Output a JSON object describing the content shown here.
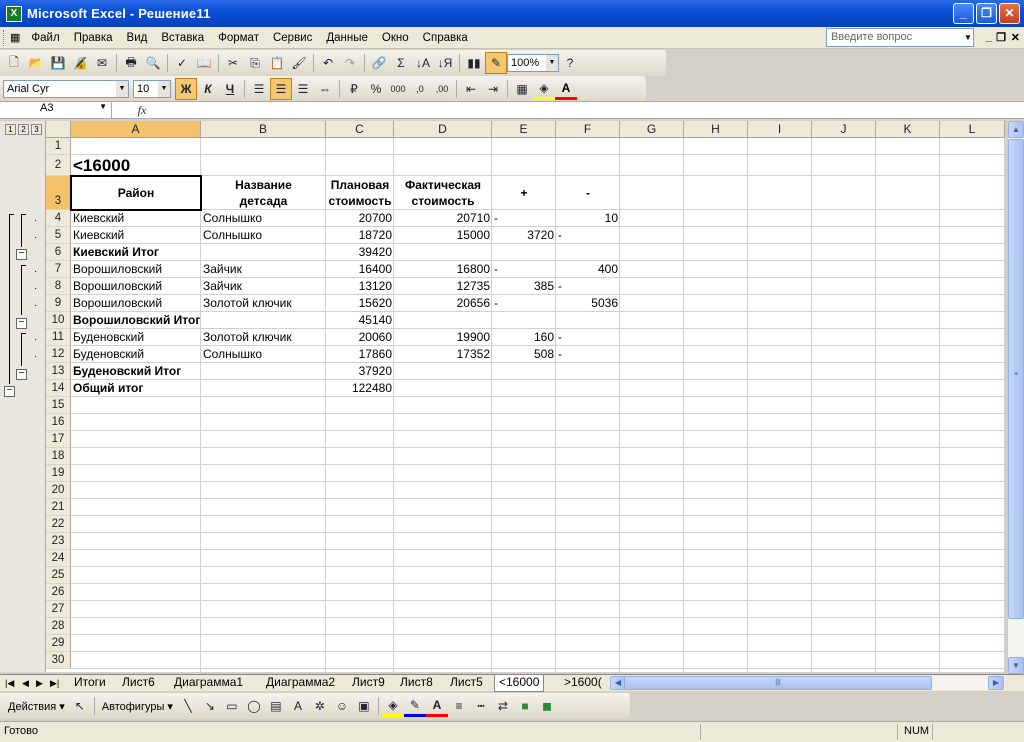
{
  "window": {
    "title": "Microsoft Excel - Решение11",
    "icon": "excel-icon"
  },
  "menu": [
    "Файл",
    "Правка",
    "Вид",
    "Вставка",
    "Формат",
    "Сервис",
    "Данные",
    "Окно",
    "Справка"
  ],
  "ask": {
    "placeholder": "Введите вопрос"
  },
  "toolbar": {
    "zoom": "100%",
    "sigma": "Σ"
  },
  "format_toolbar": {
    "font": "Arial Cyr",
    "size": "10",
    "bold": "Ж",
    "italic": "К",
    "underline": "Ч",
    "percent": "%",
    "thousands": "000"
  },
  "formula_bar": {
    "name_box": "A3",
    "fx": "fx",
    "content": ""
  },
  "outline": {
    "levels": [
      "1",
      "2",
      "3"
    ]
  },
  "columns": [
    "A",
    "B",
    "C",
    "D",
    "E",
    "F",
    "G",
    "H",
    "I",
    "J",
    "K",
    "L"
  ],
  "rows": [
    "1",
    "2",
    "3",
    "4",
    "5",
    "6",
    "7",
    "8",
    "9",
    "10",
    "11",
    "12",
    "13",
    "14",
    "15",
    "16",
    "17",
    "18",
    "19",
    "20",
    "21",
    "22",
    "23",
    "24",
    "25",
    "26",
    "27",
    "28",
    "29",
    "30"
  ],
  "sheet": {
    "title_cell": "<16000",
    "headers": {
      "a": "Район",
      "b1": "Название",
      "b2": "детсада",
      "c1": "Плановая",
      "c2": "стоимость",
      "d1": "Фактическая",
      "d2": "стоимость",
      "e": "+",
      "f": "-"
    },
    "data": [
      {
        "a": "Киевский",
        "b": "Солнышко",
        "c": "20700",
        "d": "20710",
        "e": "-",
        "f": "10"
      },
      {
        "a": "Киевский",
        "b": "Солнышко",
        "c": "18720",
        "d": "15000",
        "e": "3720",
        "f": "-"
      },
      {
        "a": "Киевский Итог",
        "b": "",
        "c": "39420",
        "d": "",
        "e": "",
        "f": ""
      },
      {
        "a": "Ворошиловский",
        "b": "Зайчик",
        "c": "16400",
        "d": "16800",
        "e": "-",
        "f": "400"
      },
      {
        "a": "Ворошиловский",
        "b": "Зайчик",
        "c": "13120",
        "d": "12735",
        "e": "385",
        "f": "-"
      },
      {
        "a": "Ворошиловский",
        "b": "Золотой ключик",
        "c": "15620",
        "d": "20656",
        "e": "-",
        "f": "5036"
      },
      {
        "a": "Ворошиловский Итог",
        "b": "",
        "c": "45140",
        "d": "",
        "e": "",
        "f": ""
      },
      {
        "a": "Буденовский",
        "b": "Золотой ключик",
        "c": "20060",
        "d": "19900",
        "e": "160",
        "f": "-"
      },
      {
        "a": "Буденовский",
        "b": "Солнышко",
        "c": "17860",
        "d": "17352",
        "e": "508",
        "f": "-"
      },
      {
        "a": "Буденовский Итог",
        "b": "",
        "c": "37920",
        "d": "",
        "e": "",
        "f": ""
      },
      {
        "a": "Общий итог",
        "b": "",
        "c": "122480",
        "d": "",
        "e": "",
        "f": ""
      }
    ]
  },
  "tabs": [
    "Итоги",
    "Лист6",
    "Диаграмма1",
    "Диаграмма2",
    "Лист9",
    "Лист8",
    "Лист5",
    "<16000",
    ">1600("
  ],
  "active_tab": "<16000",
  "drawing": {
    "actions": "Действия",
    "autoshapes": "Автофигуры"
  },
  "status": {
    "ready": "Готово",
    "num": "NUM"
  }
}
